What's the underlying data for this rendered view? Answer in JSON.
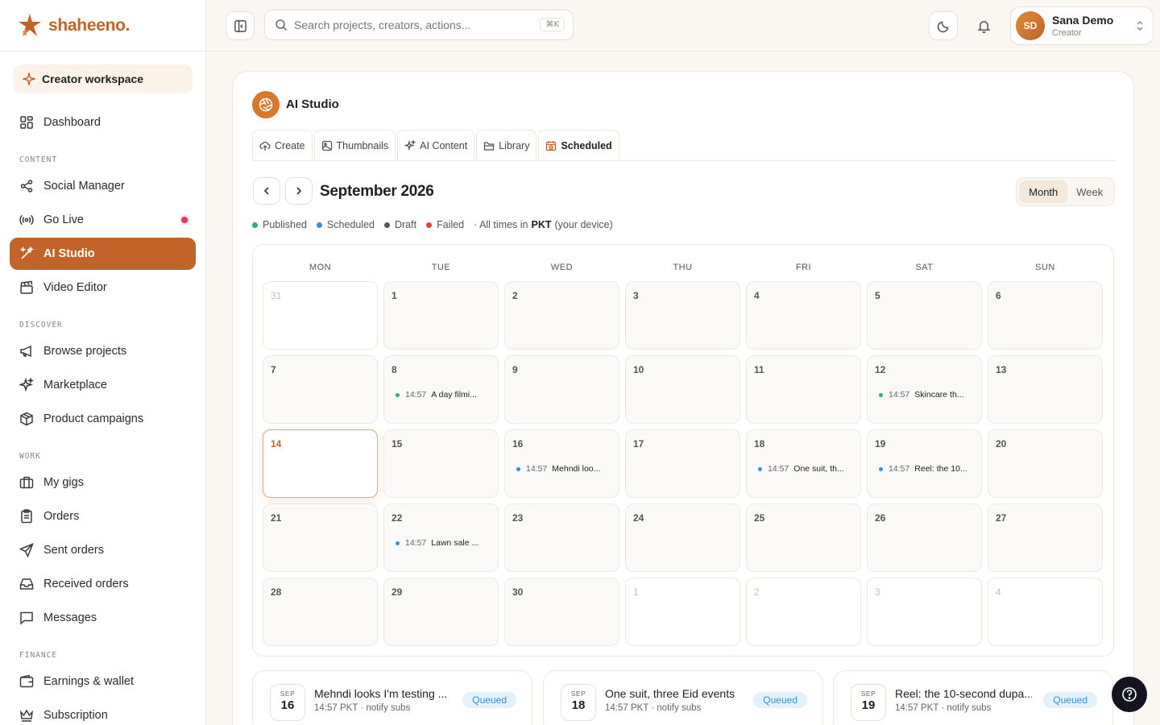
{
  "brand": {
    "name": "shaheeno."
  },
  "sidebar": {
    "workspace": "Creator workspace",
    "dashboard": "Dashboard",
    "sections": {
      "content": "CONTENT",
      "discover": "DISCOVER",
      "work": "WORK",
      "finance": "FINANCE"
    },
    "items": {
      "social_manager": "Social Manager",
      "go_live": "Go Live",
      "ai_studio": "AI Studio",
      "video_editor": "Video Editor",
      "browse_projects": "Browse projects",
      "marketplace": "Marketplace",
      "product_campaigns": "Product campaigns",
      "my_gigs": "My gigs",
      "orders": "Orders",
      "sent_orders": "Sent orders",
      "received_orders": "Received orders",
      "messages": "Messages",
      "earnings_wallet": "Earnings & wallet",
      "subscription": "Subscription"
    }
  },
  "topbar": {
    "search_placeholder": "Search projects, creators, actions...",
    "shortcut": "⌘K",
    "user": {
      "initials": "SD",
      "name": "Sana Demo",
      "role": "Creator"
    }
  },
  "studio": {
    "title": "AI Studio",
    "tabs": [
      "Create",
      "Thumbnails",
      "AI Content",
      "Library",
      "Scheduled"
    ],
    "active_tab": "Scheduled"
  },
  "calendar": {
    "month_title": "September 2026",
    "view": {
      "month": "Month",
      "week": "Week",
      "selected": "Month"
    },
    "legend": {
      "published": "Published",
      "scheduled": "Scheduled",
      "draft": "Draft",
      "failed": "Failed",
      "tz_prefix": "· All times in",
      "tz": "PKT",
      "tz_suffix": "(your device)"
    },
    "colors": {
      "published": "#2fb36b",
      "scheduled": "#3a8fd4",
      "draft": "#555555",
      "failed": "#e0453a",
      "accent": "#c2642a"
    },
    "weekdays": [
      "MON",
      "TUE",
      "WED",
      "THU",
      "FRI",
      "SAT",
      "SUN"
    ],
    "weeks": [
      [
        {
          "d": "31",
          "out": true
        },
        {
          "d": "1"
        },
        {
          "d": "2"
        },
        {
          "d": "3"
        },
        {
          "d": "4"
        },
        {
          "d": "5"
        },
        {
          "d": "6"
        }
      ],
      [
        {
          "d": "7"
        },
        {
          "d": "8",
          "ev": {
            "time": "14:57",
            "title": "A day filmi...",
            "status": "published"
          }
        },
        {
          "d": "9"
        },
        {
          "d": "10"
        },
        {
          "d": "11"
        },
        {
          "d": "12",
          "ev": {
            "time": "14:57",
            "title": "Skincare th...",
            "status": "published"
          }
        },
        {
          "d": "13"
        }
      ],
      [
        {
          "d": "14",
          "today": true
        },
        {
          "d": "15"
        },
        {
          "d": "16",
          "ev": {
            "time": "14:57",
            "title": "Mehndi loo...",
            "status": "scheduled"
          }
        },
        {
          "d": "17"
        },
        {
          "d": "18",
          "ev": {
            "time": "14:57",
            "title": "One suit, th...",
            "status": "scheduled"
          }
        },
        {
          "d": "19",
          "ev": {
            "time": "14:57",
            "title": "Reel: the 10...",
            "status": "scheduled"
          }
        },
        {
          "d": "20"
        }
      ],
      [
        {
          "d": "21"
        },
        {
          "d": "22",
          "ev": {
            "time": "14:57",
            "title": "Lawn sale ...",
            "status": "scheduled"
          }
        },
        {
          "d": "23"
        },
        {
          "d": "24"
        },
        {
          "d": "25"
        },
        {
          "d": "26"
        },
        {
          "d": "27"
        }
      ],
      [
        {
          "d": "28"
        },
        {
          "d": "29"
        },
        {
          "d": "30"
        },
        {
          "d": "1",
          "out": true
        },
        {
          "d": "2",
          "out": true
        },
        {
          "d": "3",
          "out": true
        },
        {
          "d": "4",
          "out": true
        }
      ]
    ]
  },
  "upcoming": [
    {
      "mon": "SEP",
      "day": "16",
      "title": "Mehndi looks I'm testing ...",
      "sub": "14:57 PKT · notify subs",
      "status": "Queued"
    },
    {
      "mon": "SEP",
      "day": "18",
      "title": "One suit, three Eid events",
      "sub": "14:57 PKT · notify subs",
      "status": "Queued"
    },
    {
      "mon": "SEP",
      "day": "19",
      "title": "Reel: the 10-second dupa...",
      "sub": "14:57 PKT · notify subs",
      "status": "Queued"
    }
  ]
}
